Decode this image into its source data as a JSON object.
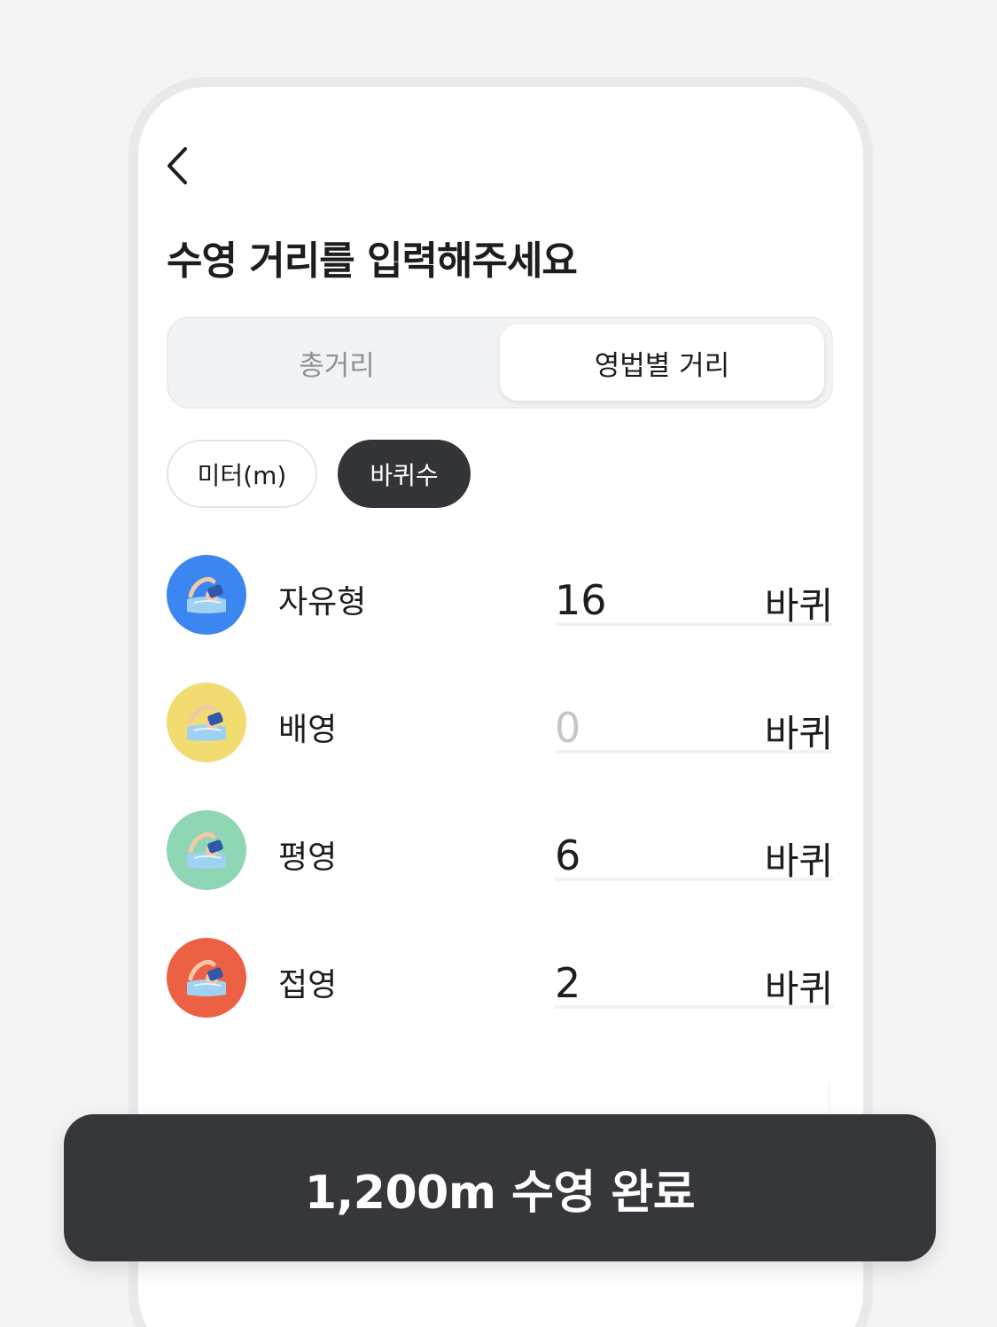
{
  "header": {
    "back_icon": "chevron-left-icon",
    "title": "수영 거리를 입력해주세요"
  },
  "segmented": {
    "options": [
      {
        "label": "총거리",
        "selected": false
      },
      {
        "label": "영법별 거리",
        "selected": true
      }
    ]
  },
  "unit_chips": [
    {
      "label": "미터(m)",
      "selected": false
    },
    {
      "label": "바퀴수",
      "selected": true
    }
  ],
  "strokes": [
    {
      "name": "자유형",
      "value": "16",
      "unit": "바퀴",
      "color": "#3b86f0",
      "icon": "swimmer-icon"
    },
    {
      "name": "배영",
      "value": "0",
      "unit": "바퀴",
      "color": "#f2dc72",
      "icon": "swimmer-icon"
    },
    {
      "name": "평영",
      "value": "6",
      "unit": "바퀴",
      "color": "#8fd6b4",
      "icon": "swimmer-icon"
    },
    {
      "name": "접영",
      "value": "2",
      "unit": "바퀴",
      "color": "#ec6143",
      "icon": "swimmer-icon"
    }
  ],
  "cta": {
    "label": "1,200m 수영 완료"
  },
  "colors": {
    "background": "#f4f4f5",
    "cta_background": "#36373a",
    "chip_selected": "#333437",
    "text_primary": "#1c1d1f",
    "text_muted": "#8e9196"
  }
}
